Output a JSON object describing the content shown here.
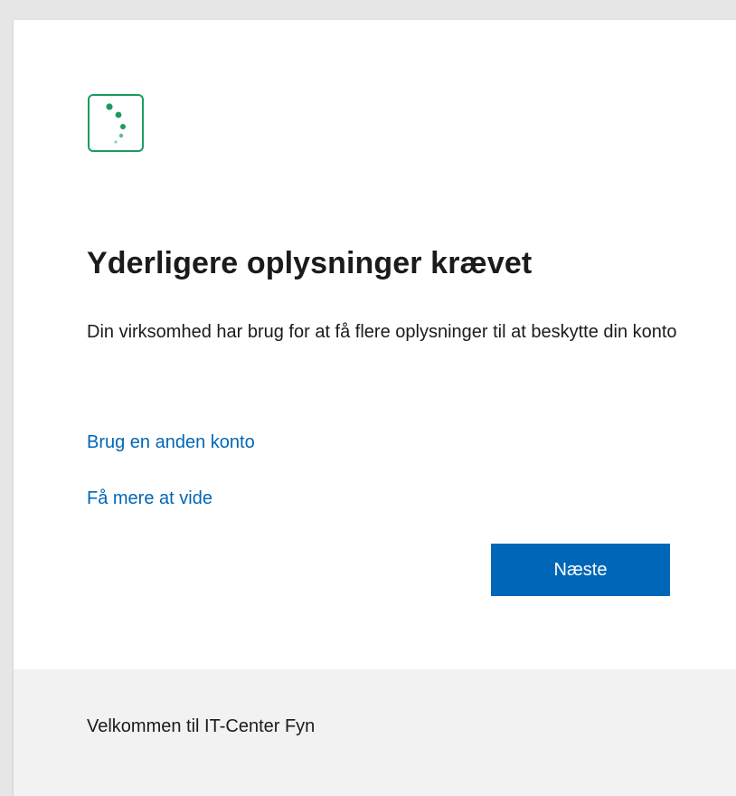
{
  "logo": {
    "icon": "dots-logo-icon",
    "color": "#1a9c60"
  },
  "heading": "Yderligere oplysninger krævet",
  "description": "Din virksomhed har brug for at få flere oplysninger til at beskytte din konto",
  "links": {
    "other_account": "Brug en anden konto",
    "learn_more": "Få mere at vide"
  },
  "buttons": {
    "next": "Næste"
  },
  "footer": {
    "text": "Velkommen til IT-Center Fyn"
  },
  "colors": {
    "accent": "#0067b8",
    "footer_bg": "#f2f2f2"
  }
}
